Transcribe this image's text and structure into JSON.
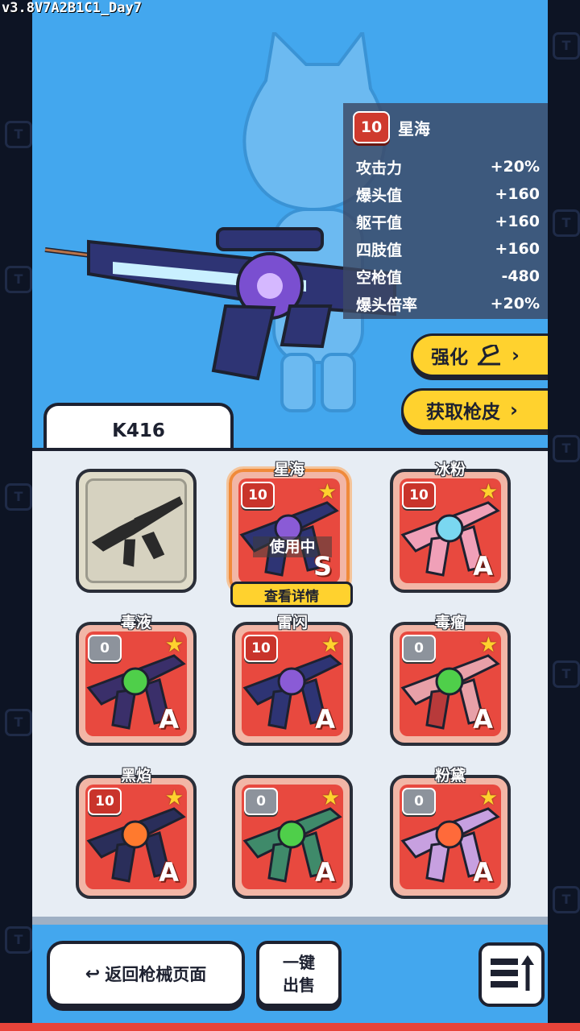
{
  "debug_version": "v3.8V7A2B1C1_Day7",
  "stats_panel": {
    "level": "10",
    "skin_name": "星海",
    "rows": [
      {
        "label": "攻击力",
        "value": "+20%"
      },
      {
        "label": "爆头值",
        "value": "+160"
      },
      {
        "label": "躯干值",
        "value": "+160"
      },
      {
        "label": "四肢值",
        "value": "+160"
      },
      {
        "label": "空枪值",
        "value": "-480"
      },
      {
        "label": "爆头倍率",
        "value": "+20%"
      }
    ]
  },
  "actions": {
    "upgrade": "强化",
    "get_skin": "获取枪皮"
  },
  "weapon_tab": "K416",
  "skins": [
    {
      "name": "",
      "level": "",
      "rank": "",
      "star": false,
      "type": "default"
    },
    {
      "name": "星海",
      "level": "10",
      "rank": "S",
      "star": true,
      "type": "selected",
      "status": "使用中",
      "color": "#8a5bd6"
    },
    {
      "name": "冰粉",
      "level": "10",
      "rank": "A",
      "star": true,
      "type": "normal",
      "color": "#7ad7f0"
    },
    {
      "name": "毒液",
      "level": "0",
      "rank": "A",
      "star": true,
      "type": "normal",
      "color": "#4fcf4a"
    },
    {
      "name": "雷闪",
      "level": "10",
      "rank": "A",
      "star": true,
      "type": "normal",
      "color": "#8a5bd6"
    },
    {
      "name": "毒瘤",
      "level": "0",
      "rank": "A",
      "star": true,
      "type": "normal",
      "color": "#4fcf4a"
    },
    {
      "name": "黑焰",
      "level": "10",
      "rank": "A",
      "star": true,
      "type": "normal",
      "color": "#ff7a2e"
    },
    {
      "name": "",
      "level": "0",
      "rank": "A",
      "star": true,
      "type": "normal",
      "color": "#4fcf4a"
    },
    {
      "name": "粉黛",
      "level": "0",
      "rank": "A",
      "star": true,
      "type": "normal",
      "color": "#ff6a3a"
    }
  ],
  "detail_button": "查看详情",
  "bottom": {
    "back": "返回枪械页面",
    "sell": "一键出售"
  }
}
